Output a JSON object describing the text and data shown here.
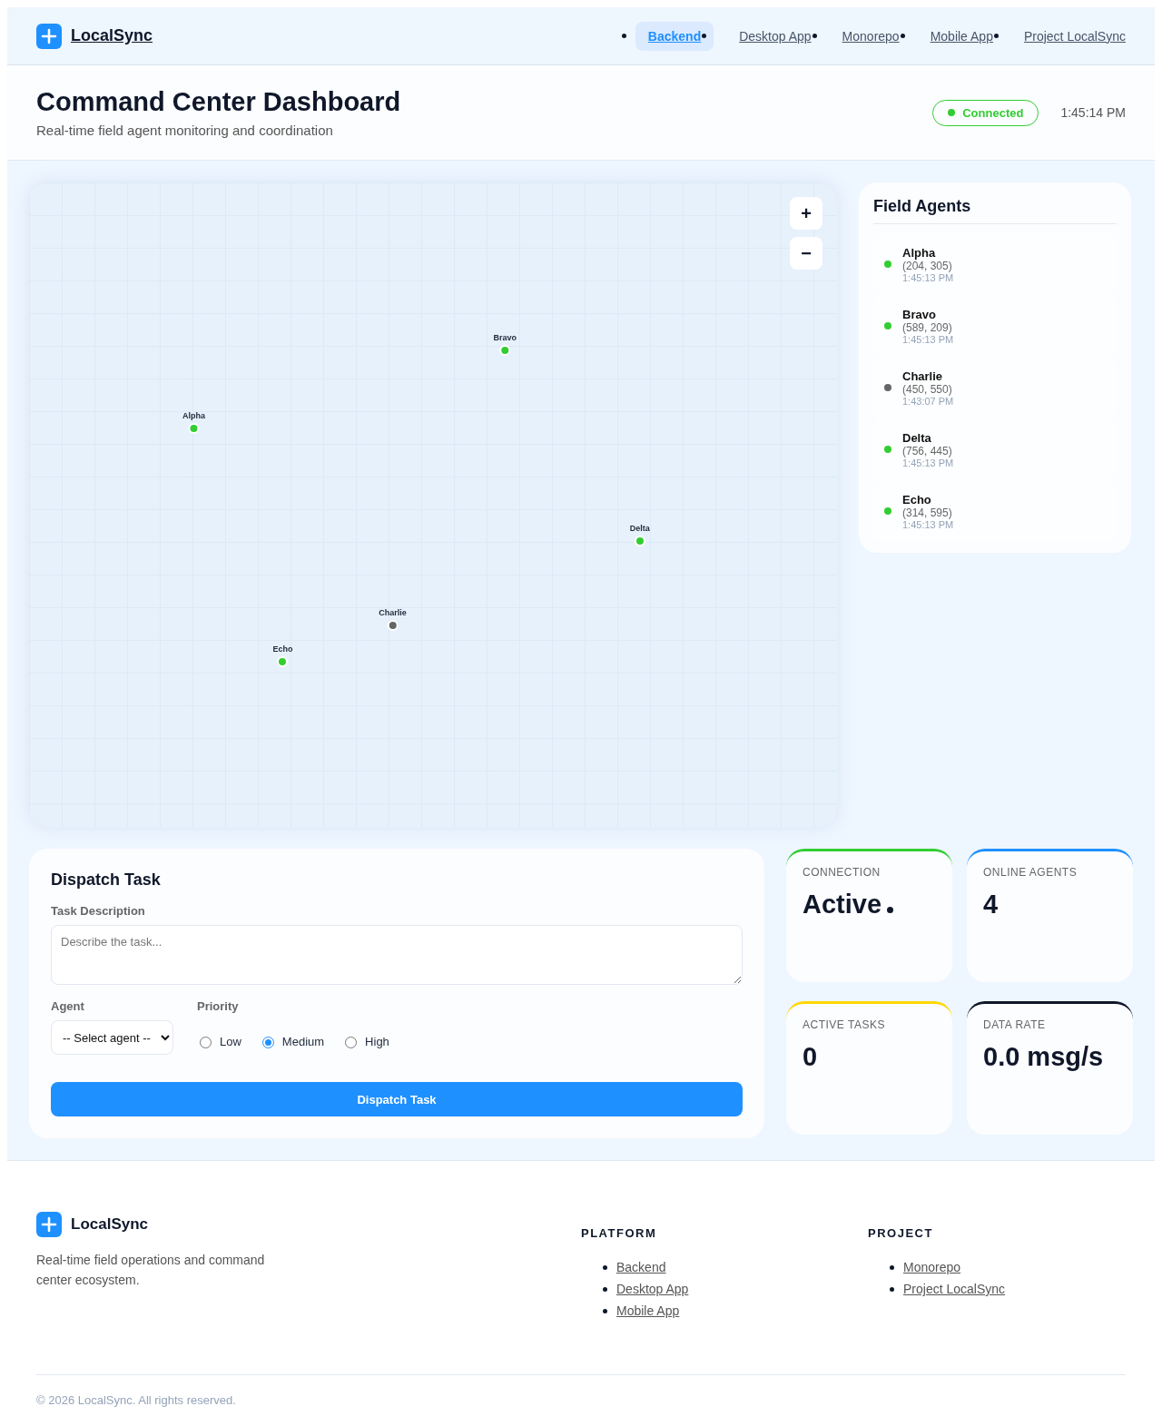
{
  "brand": {
    "name": "LocalSync"
  },
  "nav": [
    {
      "label": "Backend",
      "selected": true
    },
    {
      "label": "Desktop App",
      "selected": false
    },
    {
      "label": "Monorepo",
      "selected": false
    },
    {
      "label": "Mobile App",
      "selected": false
    },
    {
      "label": "Project LocalSync",
      "selected": false
    }
  ],
  "header": {
    "title": "Command Center Dashboard",
    "subtitle": "Real-time field agent monitoring and coordination",
    "status": {
      "label": "Connected",
      "connected": true
    },
    "time": "1:45:14 PM"
  },
  "map": {
    "zoom_in": "+",
    "zoom_out": "−",
    "pins": [
      {
        "label": "Alpha",
        "color": "#32cd32"
      },
      {
        "label": "Bravo",
        "color": "#32cd32"
      },
      {
        "label": "Charlie",
        "color": "#666666"
      },
      {
        "label": "Delta",
        "color": "#32cd32"
      },
      {
        "label": "Echo",
        "color": "#32cd32"
      }
    ]
  },
  "agents": {
    "title": "Field Agents",
    "items": [
      {
        "name": "Alpha",
        "coords": "(204, 305)",
        "time": "1:45:13 PM",
        "color": "#32cd32"
      },
      {
        "name": "Bravo",
        "coords": "(589, 209)",
        "time": "1:45:13 PM",
        "color": "#32cd32"
      },
      {
        "name": "Charlie",
        "coords": "(450, 550)",
        "time": "1:43:07 PM",
        "color": "#666666"
      },
      {
        "name": "Delta",
        "coords": "(756, 445)",
        "time": "1:45:13 PM",
        "color": "#32cd32"
      },
      {
        "name": "Echo",
        "coords": "(314, 595)",
        "time": "1:45:13 PM",
        "color": "#32cd32"
      }
    ]
  },
  "dispatch": {
    "title": "Dispatch Task",
    "description_label": "Task Description",
    "description_placeholder": "Describe the task...",
    "agent_label": "Agent",
    "agent_value": "-- Select agent --",
    "priority_label": "Priority",
    "priorities": [
      {
        "label": "Low",
        "selected": false
      },
      {
        "label": "Medium",
        "selected": true
      },
      {
        "label": "High",
        "selected": false
      }
    ],
    "submit": "Dispatch Task"
  },
  "stats": [
    {
      "label": "CONNECTION",
      "value": "Active",
      "color": "#32cd32",
      "indicator": true
    },
    {
      "label": "ONLINE AGENTS",
      "value": "4",
      "color": "#1e90ff",
      "indicator": false
    },
    {
      "label": "ACTIVE TASKS",
      "value": "0",
      "color": "#ffd700",
      "indicator": false
    },
    {
      "label": "DATA RATE",
      "value": "0.0 msg/s",
      "color": "#0f172a",
      "indicator": false
    }
  ],
  "footer": {
    "brand": "LocalSync",
    "description": "Real-time field operations and command center ecosystem.",
    "columns": [
      {
        "title": "PLATFORM",
        "links": [
          "Backend",
          "Desktop App",
          "Mobile App"
        ]
      },
      {
        "title": "PROJECT",
        "links": [
          "Monorepo",
          "Project LocalSync"
        ]
      }
    ],
    "copyright": "© 2026 LocalSync. All rights reserved."
  }
}
